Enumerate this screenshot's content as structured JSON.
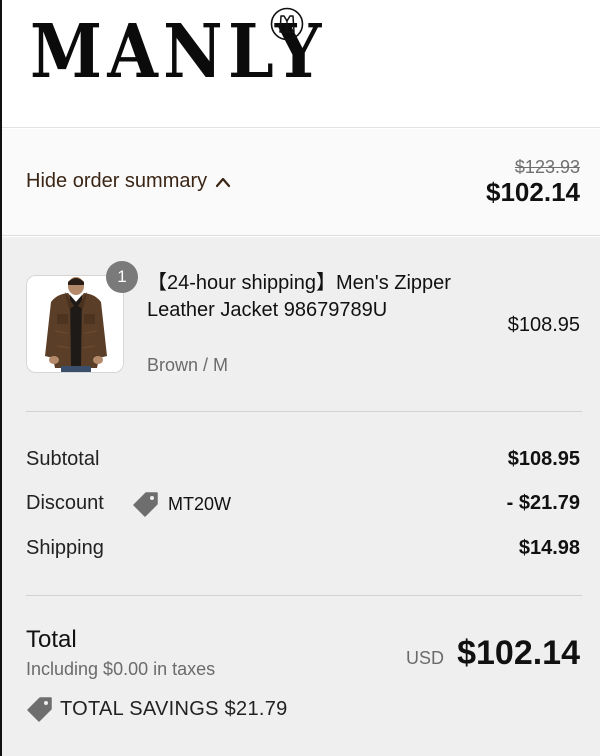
{
  "brand": {
    "name": "MANLY",
    "logo_mark_icon": "vest-emblem-icon"
  },
  "summary_toggle": {
    "label": "Hide order summary",
    "icon": "chevron-up-icon",
    "compare_at_total": "$123.93",
    "total": "$102.14"
  },
  "line_item": {
    "quantity": "1",
    "title": "【24-hour shipping】Men's Zipper Leather Jacket 98679789U",
    "variant": "Brown / M",
    "price": "$108.95",
    "image_icon": "brown-leather-jacket-photo"
  },
  "totals": {
    "subtotal_label": "Subtotal",
    "subtotal_value": "$108.95",
    "discount_label": "Discount",
    "discount_code": "MT20W",
    "discount_value": "- $21.79",
    "shipping_label": "Shipping",
    "shipping_value": "$14.98",
    "total_label": "Total",
    "tax_note": "Including $0.00 in taxes",
    "currency": "USD",
    "grand_total": "$102.14",
    "savings_text": "TOTAL SAVINGS $21.79"
  },
  "colors": {
    "accent_text": "#3b2616",
    "tag_icon": "#6e6e6e",
    "badge": "#7a7a7a",
    "summary_bg": "#efefef"
  }
}
